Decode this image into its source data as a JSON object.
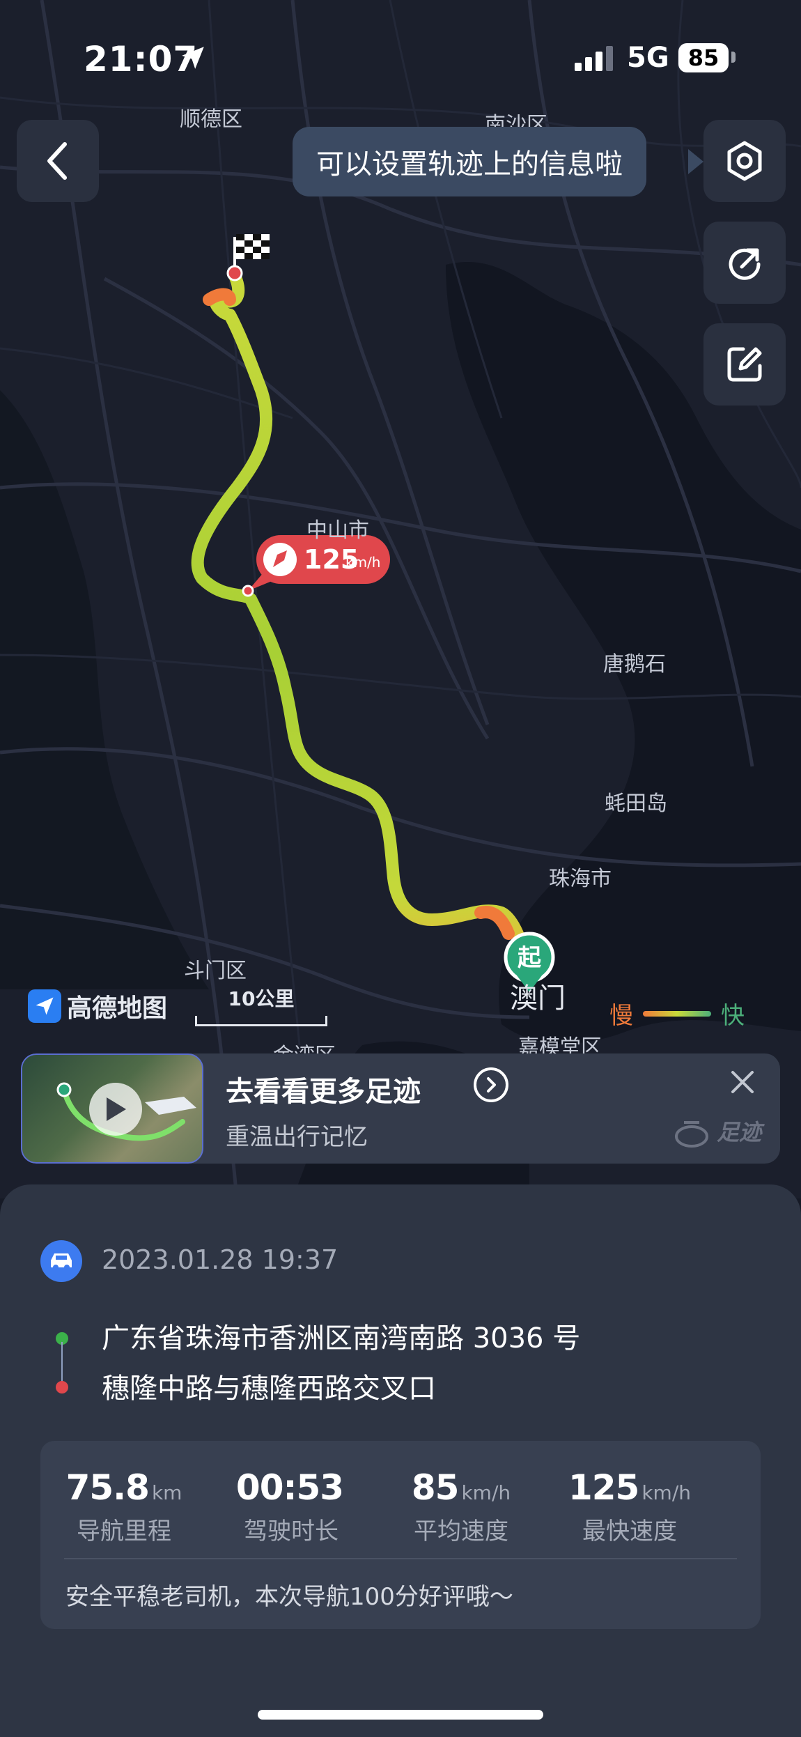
{
  "status_bar": {
    "time": "21:07",
    "network": "5G",
    "battery": "85"
  },
  "tooltip": "可以设置轨迹上的信息啦",
  "map": {
    "labels": [
      "顺德区",
      "南沙区",
      "中山市",
      "唐鹅石",
      "蚝田岛",
      "珠海市",
      "斗门区",
      "金湾区",
      "嘉模堂区"
    ],
    "macau_label": "澳门",
    "start_marker": "起",
    "max_speed_marker": {
      "value": "125",
      "unit": "km/h"
    },
    "brand": "高德地图",
    "scale": "10公里",
    "legend": {
      "slow": "慢",
      "fast": "快"
    },
    "colors": {
      "slow": "#f07a3a",
      "mid": "#c8d93a",
      "fast": "#4caf7a",
      "marker_red": "#e0474c"
    }
  },
  "promo": {
    "title": "去看看更多足迹",
    "subtitle": "重温出行记忆",
    "watermark": "足迹"
  },
  "trip": {
    "datetime": "2023.01.28 19:37",
    "start_address": "广东省珠海市香洲区南湾南路 3036 号",
    "end_address": "穗隆中路与穗隆西路交叉口",
    "stats": [
      {
        "value": "75.8",
        "unit": "km",
        "label": "导航里程"
      },
      {
        "value": "00:53",
        "unit": "",
        "label": "驾驶时长"
      },
      {
        "value": "85",
        "unit": "km/h",
        "label": "平均速度"
      },
      {
        "value": "125",
        "unit": "km/h",
        "label": "最快速度"
      }
    ],
    "comment": "安全平稳老司机，本次导航100分好评哦～"
  }
}
